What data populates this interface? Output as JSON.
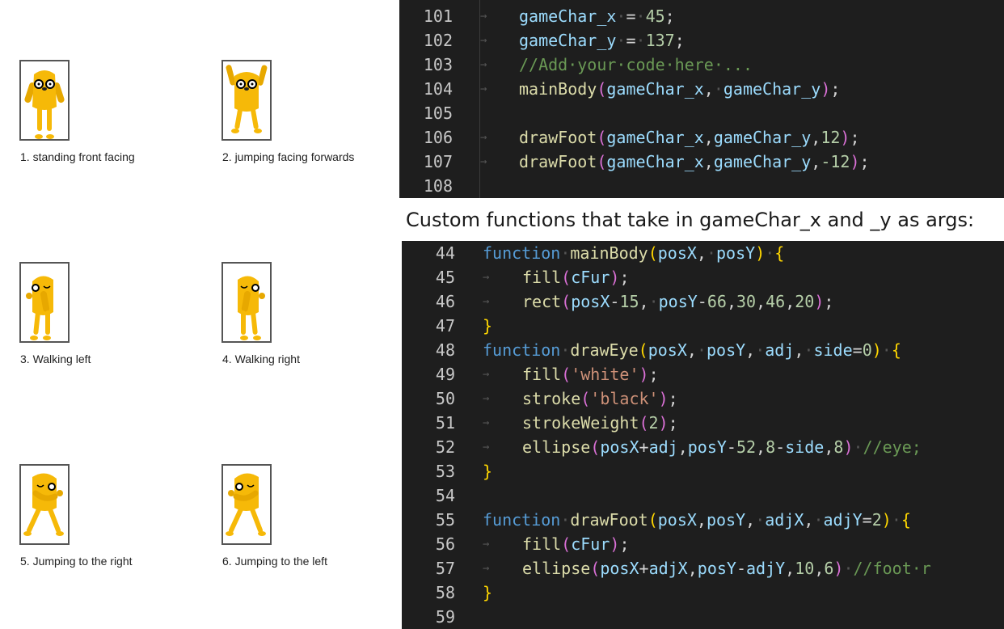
{
  "captions": [
    "1. standing front facing",
    "2. jumping facing forwards",
    "3. Walking left",
    "4. Walking right",
    "5. Jumping to the right",
    "6. Jumping to the left"
  ],
  "top_code": [
    {
      "num": "101",
      "tab": true,
      "tokens": [
        [
          "gameChar_x",
          "t-var"
        ],
        [
          "·",
          "t-dot"
        ],
        [
          "=",
          "t-op"
        ],
        [
          "·",
          "t-dot"
        ],
        [
          "45",
          "t-num"
        ],
        [
          ";",
          "t-op"
        ]
      ]
    },
    {
      "num": "102",
      "tab": true,
      "tokens": [
        [
          "gameChar_y",
          "t-var"
        ],
        [
          "·",
          "t-dot"
        ],
        [
          "=",
          "t-op"
        ],
        [
          "·",
          "t-dot"
        ],
        [
          "137",
          "t-num"
        ],
        [
          ";",
          "t-op"
        ]
      ]
    },
    {
      "num": "103",
      "tab": true,
      "tokens": [
        [
          "//Add·your·code·here·...",
          "t-com"
        ]
      ]
    },
    {
      "num": "104",
      "tab": true,
      "tokens": [
        [
          "mainBody",
          "t-fn"
        ],
        [
          "(",
          "t-p2"
        ],
        [
          "gameChar_x",
          "t-var"
        ],
        [
          ",",
          "t-op"
        ],
        [
          "·",
          "t-dot"
        ],
        [
          "gameChar_y",
          "t-var"
        ],
        [
          ")",
          "t-p2"
        ],
        [
          ";",
          "t-op"
        ]
      ]
    },
    {
      "num": "105",
      "tab": false,
      "tokens": []
    },
    {
      "num": "106",
      "tab": true,
      "tokens": [
        [
          "drawFoot",
          "t-fn"
        ],
        [
          "(",
          "t-p2"
        ],
        [
          "gameChar_x",
          "t-var"
        ],
        [
          ",",
          "t-op"
        ],
        [
          "gameChar_y",
          "t-var"
        ],
        [
          ",",
          "t-op"
        ],
        [
          "12",
          "t-num"
        ],
        [
          ")",
          "t-p2"
        ],
        [
          ";",
          "t-op"
        ]
      ]
    },
    {
      "num": "107",
      "tab": true,
      "tokens": [
        [
          "drawFoot",
          "t-fn"
        ],
        [
          "(",
          "t-p2"
        ],
        [
          "gameChar_x",
          "t-var"
        ],
        [
          ",",
          "t-op"
        ],
        [
          "gameChar_y",
          "t-var"
        ],
        [
          ",",
          "t-op"
        ],
        [
          "-12",
          "t-num"
        ],
        [
          ")",
          "t-p2"
        ],
        [
          ";",
          "t-op"
        ]
      ]
    },
    {
      "num": "108",
      "tab": false,
      "tokens": []
    }
  ],
  "heading": "Custom functions that take in gameChar_x and _y as args:",
  "bottom_code": [
    {
      "num": "44",
      "tab": false,
      "indent": false,
      "tokens": [
        [
          "function",
          "t-kw"
        ],
        [
          "·",
          "t-dot"
        ],
        [
          "mainBody",
          "t-fn"
        ],
        [
          "(",
          "t-p1"
        ],
        [
          "posX",
          "t-var"
        ],
        [
          ",",
          "t-op"
        ],
        [
          "·",
          "t-dot"
        ],
        [
          "posY",
          "t-var"
        ],
        [
          ")",
          "t-p1"
        ],
        [
          "·",
          "t-dot"
        ],
        [
          "{",
          "t-p1"
        ]
      ]
    },
    {
      "num": "45",
      "tab": true,
      "indent": true,
      "tokens": [
        [
          "fill",
          "t-fn"
        ],
        [
          "(",
          "t-p2"
        ],
        [
          "cFur",
          "t-var"
        ],
        [
          ")",
          "t-p2"
        ],
        [
          ";",
          "t-op"
        ]
      ]
    },
    {
      "num": "46",
      "tab": true,
      "indent": true,
      "tokens": [
        [
          "rect",
          "t-fn"
        ],
        [
          "(",
          "t-p2"
        ],
        [
          "posX",
          "t-var"
        ],
        [
          "-",
          "t-op"
        ],
        [
          "15",
          "t-num"
        ],
        [
          ",",
          "t-op"
        ],
        [
          "·",
          "t-dot"
        ],
        [
          "posY",
          "t-var"
        ],
        [
          "-",
          "t-op"
        ],
        [
          "66",
          "t-num"
        ],
        [
          ",",
          "t-op"
        ],
        [
          "30",
          "t-num"
        ],
        [
          ",",
          "t-op"
        ],
        [
          "46",
          "t-num"
        ],
        [
          ",",
          "t-op"
        ],
        [
          "20",
          "t-num"
        ],
        [
          ")",
          "t-p2"
        ],
        [
          ";",
          "t-op"
        ]
      ]
    },
    {
      "num": "47",
      "tab": false,
      "indent": false,
      "tokens": [
        [
          "}",
          "t-p1"
        ]
      ]
    },
    {
      "num": "48",
      "tab": false,
      "indent": false,
      "tokens": [
        [
          "function",
          "t-kw"
        ],
        [
          "·",
          "t-dot"
        ],
        [
          "drawEye",
          "t-fn"
        ],
        [
          "(",
          "t-p1"
        ],
        [
          "posX",
          "t-var"
        ],
        [
          ",",
          "t-op"
        ],
        [
          "·",
          "t-dot"
        ],
        [
          "posY",
          "t-var"
        ],
        [
          ",",
          "t-op"
        ],
        [
          "·",
          "t-dot"
        ],
        [
          "adj",
          "t-var"
        ],
        [
          ",",
          "t-op"
        ],
        [
          "·",
          "t-dot"
        ],
        [
          "side",
          "t-var"
        ],
        [
          "=",
          "t-op"
        ],
        [
          "0",
          "t-num"
        ],
        [
          ")",
          "t-p1"
        ],
        [
          "·",
          "t-dot"
        ],
        [
          "{",
          "t-p1"
        ]
      ]
    },
    {
      "num": "49",
      "tab": true,
      "indent": true,
      "tokens": [
        [
          "fill",
          "t-fn"
        ],
        [
          "(",
          "t-p2"
        ],
        [
          "'white'",
          "t-str"
        ],
        [
          ")",
          "t-p2"
        ],
        [
          ";",
          "t-op"
        ]
      ]
    },
    {
      "num": "50",
      "tab": true,
      "indent": true,
      "tokens": [
        [
          "stroke",
          "t-fn"
        ],
        [
          "(",
          "t-p2"
        ],
        [
          "'black'",
          "t-str"
        ],
        [
          ")",
          "t-p2"
        ],
        [
          ";",
          "t-op"
        ]
      ]
    },
    {
      "num": "51",
      "tab": true,
      "indent": true,
      "tokens": [
        [
          "strokeWeight",
          "t-fn"
        ],
        [
          "(",
          "t-p2"
        ],
        [
          "2",
          "t-num"
        ],
        [
          ")",
          "t-p2"
        ],
        [
          ";",
          "t-op"
        ]
      ]
    },
    {
      "num": "52",
      "tab": true,
      "indent": true,
      "tokens": [
        [
          "ellipse",
          "t-fn"
        ],
        [
          "(",
          "t-p2"
        ],
        [
          "posX",
          "t-var"
        ],
        [
          "+",
          "t-op"
        ],
        [
          "adj",
          "t-var"
        ],
        [
          ",",
          "t-op"
        ],
        [
          "posY",
          "t-var"
        ],
        [
          "-",
          "t-op"
        ],
        [
          "52",
          "t-num"
        ],
        [
          ",",
          "t-op"
        ],
        [
          "8",
          "t-num"
        ],
        [
          "-",
          "t-op"
        ],
        [
          "side",
          "t-var"
        ],
        [
          ",",
          "t-op"
        ],
        [
          "8",
          "t-num"
        ],
        [
          ")",
          "t-p2"
        ],
        [
          "·",
          "t-dot"
        ],
        [
          "//eye;",
          "t-com"
        ]
      ]
    },
    {
      "num": "53",
      "tab": false,
      "indent": false,
      "tokens": [
        [
          "}",
          "t-p1"
        ]
      ]
    },
    {
      "num": "54",
      "tab": false,
      "indent": false,
      "tokens": []
    },
    {
      "num": "55",
      "tab": false,
      "indent": false,
      "tokens": [
        [
          "function",
          "t-kw"
        ],
        [
          "·",
          "t-dot"
        ],
        [
          "drawFoot",
          "t-fn"
        ],
        [
          "(",
          "t-p1"
        ],
        [
          "posX",
          "t-var"
        ],
        [
          ",",
          "t-op"
        ],
        [
          "posY",
          "t-var"
        ],
        [
          ",",
          "t-op"
        ],
        [
          "·",
          "t-dot"
        ],
        [
          "adjX",
          "t-var"
        ],
        [
          ",",
          "t-op"
        ],
        [
          "·",
          "t-dot"
        ],
        [
          "adjY",
          "t-var"
        ],
        [
          "=",
          "t-op"
        ],
        [
          "2",
          "t-num"
        ],
        [
          ")",
          "t-p1"
        ],
        [
          "·",
          "t-dot"
        ],
        [
          "{",
          "t-p1"
        ]
      ]
    },
    {
      "num": "56",
      "tab": true,
      "indent": true,
      "tokens": [
        [
          "fill",
          "t-fn"
        ],
        [
          "(",
          "t-p2"
        ],
        [
          "cFur",
          "t-var"
        ],
        [
          ")",
          "t-p2"
        ],
        [
          ";",
          "t-op"
        ]
      ]
    },
    {
      "num": "57",
      "tab": true,
      "indent": true,
      "tokens": [
        [
          "ellipse",
          "t-fn"
        ],
        [
          "(",
          "t-p2"
        ],
        [
          "posX",
          "t-var"
        ],
        [
          "+",
          "t-op"
        ],
        [
          "adjX",
          "t-var"
        ],
        [
          ",",
          "t-op"
        ],
        [
          "posY",
          "t-var"
        ],
        [
          "-",
          "t-op"
        ],
        [
          "adjY",
          "t-var"
        ],
        [
          ",",
          "t-op"
        ],
        [
          "10",
          "t-num"
        ],
        [
          ",",
          "t-op"
        ],
        [
          "6",
          "t-num"
        ],
        [
          ")",
          "t-p2"
        ],
        [
          "·",
          "t-dot"
        ],
        [
          "//foot·r",
          "t-com"
        ]
      ]
    },
    {
      "num": "58",
      "tab": false,
      "indent": false,
      "tokens": [
        [
          "}",
          "t-p1"
        ]
      ]
    },
    {
      "num": "59",
      "tab": false,
      "indent": false,
      "tokens": []
    }
  ],
  "colors": {
    "fur": "#f6b908",
    "fur_dark": "#e0a000",
    "editor_bg": "#1e1e1e"
  }
}
